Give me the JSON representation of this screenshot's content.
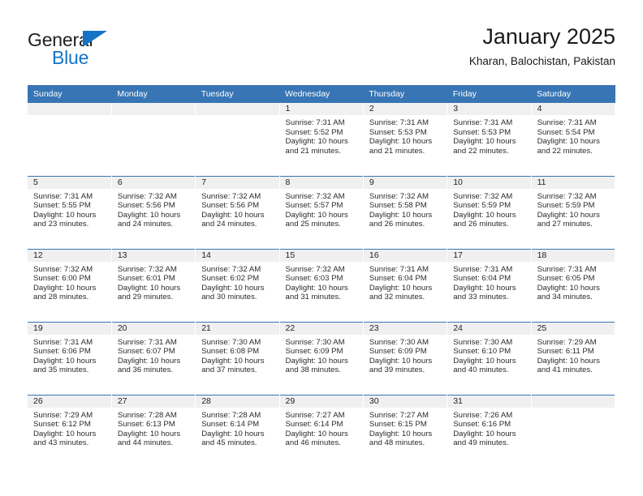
{
  "brand": {
    "name_part1": "General",
    "name_part2": "Blue",
    "triangle_icon": "triangle-icon",
    "color_dark": "#231f20",
    "color_blue": "#1573c6"
  },
  "header": {
    "title": "January 2025",
    "subtitle": "Kharan, Balochistan, Pakistan"
  },
  "calendar": {
    "header_bg": "#3875b4",
    "daynum_bg": "#f0f0f0",
    "weekday_headers": [
      "Sunday",
      "Monday",
      "Tuesday",
      "Wednesday",
      "Thursday",
      "Friday",
      "Saturday"
    ],
    "weeks": [
      [
        {
          "day": "",
          "empty": true,
          "sunrise": "",
          "sunset": "",
          "daylight_line1": "",
          "daylight_line2": ""
        },
        {
          "day": "",
          "empty": true,
          "sunrise": "",
          "sunset": "",
          "daylight_line1": "",
          "daylight_line2": ""
        },
        {
          "day": "",
          "empty": true,
          "sunrise": "",
          "sunset": "",
          "daylight_line1": "",
          "daylight_line2": ""
        },
        {
          "day": "1",
          "empty": false,
          "sunrise": "Sunrise: 7:31 AM",
          "sunset": "Sunset: 5:52 PM",
          "daylight_line1": "Daylight: 10 hours",
          "daylight_line2": "and 21 minutes."
        },
        {
          "day": "2",
          "empty": false,
          "sunrise": "Sunrise: 7:31 AM",
          "sunset": "Sunset: 5:53 PM",
          "daylight_line1": "Daylight: 10 hours",
          "daylight_line2": "and 21 minutes."
        },
        {
          "day": "3",
          "empty": false,
          "sunrise": "Sunrise: 7:31 AM",
          "sunset": "Sunset: 5:53 PM",
          "daylight_line1": "Daylight: 10 hours",
          "daylight_line2": "and 22 minutes."
        },
        {
          "day": "4",
          "empty": false,
          "sunrise": "Sunrise: 7:31 AM",
          "sunset": "Sunset: 5:54 PM",
          "daylight_line1": "Daylight: 10 hours",
          "daylight_line2": "and 22 minutes."
        }
      ],
      [
        {
          "day": "5",
          "empty": false,
          "sunrise": "Sunrise: 7:31 AM",
          "sunset": "Sunset: 5:55 PM",
          "daylight_line1": "Daylight: 10 hours",
          "daylight_line2": "and 23 minutes."
        },
        {
          "day": "6",
          "empty": false,
          "sunrise": "Sunrise: 7:32 AM",
          "sunset": "Sunset: 5:56 PM",
          "daylight_line1": "Daylight: 10 hours",
          "daylight_line2": "and 24 minutes."
        },
        {
          "day": "7",
          "empty": false,
          "sunrise": "Sunrise: 7:32 AM",
          "sunset": "Sunset: 5:56 PM",
          "daylight_line1": "Daylight: 10 hours",
          "daylight_line2": "and 24 minutes."
        },
        {
          "day": "8",
          "empty": false,
          "sunrise": "Sunrise: 7:32 AM",
          "sunset": "Sunset: 5:57 PM",
          "daylight_line1": "Daylight: 10 hours",
          "daylight_line2": "and 25 minutes."
        },
        {
          "day": "9",
          "empty": false,
          "sunrise": "Sunrise: 7:32 AM",
          "sunset": "Sunset: 5:58 PM",
          "daylight_line1": "Daylight: 10 hours",
          "daylight_line2": "and 26 minutes."
        },
        {
          "day": "10",
          "empty": false,
          "sunrise": "Sunrise: 7:32 AM",
          "sunset": "Sunset: 5:59 PM",
          "daylight_line1": "Daylight: 10 hours",
          "daylight_line2": "and 26 minutes."
        },
        {
          "day": "11",
          "empty": false,
          "sunrise": "Sunrise: 7:32 AM",
          "sunset": "Sunset: 5:59 PM",
          "daylight_line1": "Daylight: 10 hours",
          "daylight_line2": "and 27 minutes."
        }
      ],
      [
        {
          "day": "12",
          "empty": false,
          "sunrise": "Sunrise: 7:32 AM",
          "sunset": "Sunset: 6:00 PM",
          "daylight_line1": "Daylight: 10 hours",
          "daylight_line2": "and 28 minutes."
        },
        {
          "day": "13",
          "empty": false,
          "sunrise": "Sunrise: 7:32 AM",
          "sunset": "Sunset: 6:01 PM",
          "daylight_line1": "Daylight: 10 hours",
          "daylight_line2": "and 29 minutes."
        },
        {
          "day": "14",
          "empty": false,
          "sunrise": "Sunrise: 7:32 AM",
          "sunset": "Sunset: 6:02 PM",
          "daylight_line1": "Daylight: 10 hours",
          "daylight_line2": "and 30 minutes."
        },
        {
          "day": "15",
          "empty": false,
          "sunrise": "Sunrise: 7:32 AM",
          "sunset": "Sunset: 6:03 PM",
          "daylight_line1": "Daylight: 10 hours",
          "daylight_line2": "and 31 minutes."
        },
        {
          "day": "16",
          "empty": false,
          "sunrise": "Sunrise: 7:31 AM",
          "sunset": "Sunset: 6:04 PM",
          "daylight_line1": "Daylight: 10 hours",
          "daylight_line2": "and 32 minutes."
        },
        {
          "day": "17",
          "empty": false,
          "sunrise": "Sunrise: 7:31 AM",
          "sunset": "Sunset: 6:04 PM",
          "daylight_line1": "Daylight: 10 hours",
          "daylight_line2": "and 33 minutes."
        },
        {
          "day": "18",
          "empty": false,
          "sunrise": "Sunrise: 7:31 AM",
          "sunset": "Sunset: 6:05 PM",
          "daylight_line1": "Daylight: 10 hours",
          "daylight_line2": "and 34 minutes."
        }
      ],
      [
        {
          "day": "19",
          "empty": false,
          "sunrise": "Sunrise: 7:31 AM",
          "sunset": "Sunset: 6:06 PM",
          "daylight_line1": "Daylight: 10 hours",
          "daylight_line2": "and 35 minutes."
        },
        {
          "day": "20",
          "empty": false,
          "sunrise": "Sunrise: 7:31 AM",
          "sunset": "Sunset: 6:07 PM",
          "daylight_line1": "Daylight: 10 hours",
          "daylight_line2": "and 36 minutes."
        },
        {
          "day": "21",
          "empty": false,
          "sunrise": "Sunrise: 7:30 AM",
          "sunset": "Sunset: 6:08 PM",
          "daylight_line1": "Daylight: 10 hours",
          "daylight_line2": "and 37 minutes."
        },
        {
          "day": "22",
          "empty": false,
          "sunrise": "Sunrise: 7:30 AM",
          "sunset": "Sunset: 6:09 PM",
          "daylight_line1": "Daylight: 10 hours",
          "daylight_line2": "and 38 minutes."
        },
        {
          "day": "23",
          "empty": false,
          "sunrise": "Sunrise: 7:30 AM",
          "sunset": "Sunset: 6:09 PM",
          "daylight_line1": "Daylight: 10 hours",
          "daylight_line2": "and 39 minutes."
        },
        {
          "day": "24",
          "empty": false,
          "sunrise": "Sunrise: 7:30 AM",
          "sunset": "Sunset: 6:10 PM",
          "daylight_line1": "Daylight: 10 hours",
          "daylight_line2": "and 40 minutes."
        },
        {
          "day": "25",
          "empty": false,
          "sunrise": "Sunrise: 7:29 AM",
          "sunset": "Sunset: 6:11 PM",
          "daylight_line1": "Daylight: 10 hours",
          "daylight_line2": "and 41 minutes."
        }
      ],
      [
        {
          "day": "26",
          "empty": false,
          "sunrise": "Sunrise: 7:29 AM",
          "sunset": "Sunset: 6:12 PM",
          "daylight_line1": "Daylight: 10 hours",
          "daylight_line2": "and 43 minutes."
        },
        {
          "day": "27",
          "empty": false,
          "sunrise": "Sunrise: 7:28 AM",
          "sunset": "Sunset: 6:13 PM",
          "daylight_line1": "Daylight: 10 hours",
          "daylight_line2": "and 44 minutes."
        },
        {
          "day": "28",
          "empty": false,
          "sunrise": "Sunrise: 7:28 AM",
          "sunset": "Sunset: 6:14 PM",
          "daylight_line1": "Daylight: 10 hours",
          "daylight_line2": "and 45 minutes."
        },
        {
          "day": "29",
          "empty": false,
          "sunrise": "Sunrise: 7:27 AM",
          "sunset": "Sunset: 6:14 PM",
          "daylight_line1": "Daylight: 10 hours",
          "daylight_line2": "and 46 minutes."
        },
        {
          "day": "30",
          "empty": false,
          "sunrise": "Sunrise: 7:27 AM",
          "sunset": "Sunset: 6:15 PM",
          "daylight_line1": "Daylight: 10 hours",
          "daylight_line2": "and 48 minutes."
        },
        {
          "day": "31",
          "empty": false,
          "sunrise": "Sunrise: 7:26 AM",
          "sunset": "Sunset: 6:16 PM",
          "daylight_line1": "Daylight: 10 hours",
          "daylight_line2": "and 49 minutes."
        },
        {
          "day": "",
          "empty": true,
          "sunrise": "",
          "sunset": "",
          "daylight_line1": "",
          "daylight_line2": ""
        }
      ]
    ]
  }
}
